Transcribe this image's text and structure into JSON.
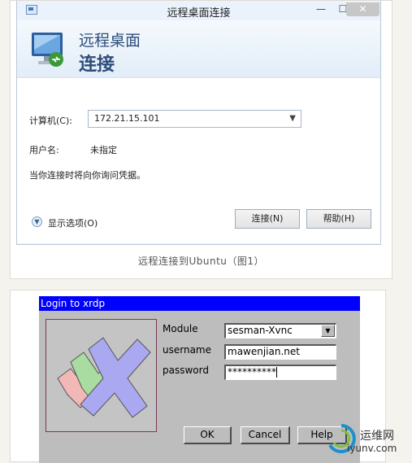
{
  "rdp": {
    "window_title": "远程桌面连接",
    "min_glyph": "—",
    "max_glyph": "☐",
    "close_glyph": "✕",
    "banner_line1": "远程桌面",
    "banner_line2": "连接",
    "computer_label": "计算机(C):",
    "computer_value": "172.21.15.101",
    "username_label": "用户名:",
    "username_value": "未指定",
    "info_text": "当你连接时将向你询问凭据。",
    "show_options": "显示选项(O)",
    "connect_button": "连接(N)",
    "help_button": "帮助(H)"
  },
  "caption": "远程连接到Ubuntu（图1）",
  "xrdp": {
    "title": "Login to xrdp",
    "module_label": "Module",
    "module_value": "sesman-Xvnc",
    "username_label": "username",
    "username_value": "mawenjian.net",
    "password_label": "password",
    "password_masked": "**********",
    "ok_button": "OK",
    "cancel_button": "Cancel",
    "help_button": "Help"
  },
  "watermark": {
    "line1": "运维网",
    "line2": "iyunv.com"
  },
  "colors": {
    "xrdp_title_bg": "#0000fe",
    "rdp_banner_text": "#2d4d7b"
  }
}
